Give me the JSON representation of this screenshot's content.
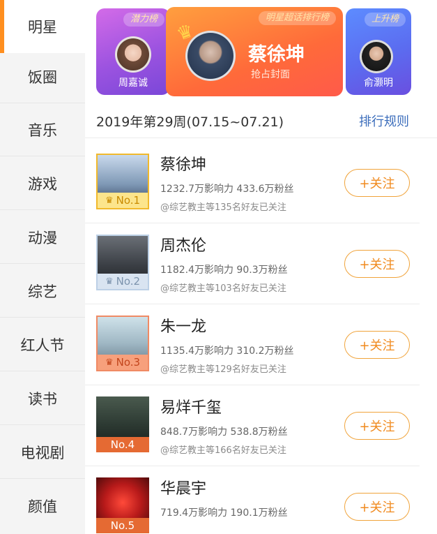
{
  "sidebar": {
    "items": [
      {
        "label": "明星",
        "active": true
      },
      {
        "label": "饭圈"
      },
      {
        "label": "音乐"
      },
      {
        "label": "游戏"
      },
      {
        "label": "动漫"
      },
      {
        "label": "综艺"
      },
      {
        "label": "红人节"
      },
      {
        "label": "读书"
      },
      {
        "label": "电视剧"
      },
      {
        "label": "颜值"
      }
    ],
    "accent_color": "#ff8f1f"
  },
  "banner": {
    "left_card": {
      "tag": "潜力榜",
      "name": "周嘉诚"
    },
    "center_card": {
      "tag": "明星超话排行榜",
      "title": "蔡徐坤",
      "subtitle": "抢占封面"
    },
    "right_card": {
      "tag": "上升榜",
      "name": "俞灏明"
    }
  },
  "header": {
    "week": "2019年第29周(07.15~07.21)",
    "rules_link": "排行规则"
  },
  "ranking": [
    {
      "name": "蔡徐坤",
      "stats": "1232.7万影响力 433.6万粉丝",
      "friends": "@综艺教主等135名好友已关注",
      "rank": "No.1",
      "follow": "+关注"
    },
    {
      "name": "周杰伦",
      "stats": "1182.4万影响力 90.3万粉丝",
      "friends": "@综艺教主等103名好友已关注",
      "rank": "No.2",
      "follow": "+关注"
    },
    {
      "name": "朱一龙",
      "stats": "1135.4万影响力 310.2万粉丝",
      "friends": "@综艺教主等129名好友已关注",
      "rank": "No.3",
      "follow": "+关注"
    },
    {
      "name": "易烊千玺",
      "stats": "848.7万影响力 538.8万粉丝",
      "friends": "@综艺教主等166名好友已关注",
      "rank": "No.4",
      "follow": "+关注"
    },
    {
      "name": "华晨宇",
      "stats": "719.4万影响力 190.1万粉丝",
      "friends": "",
      "rank": "No.5",
      "follow": "+关注"
    }
  ],
  "colors": {
    "follow": "#f08a1e",
    "link": "#3b6dbb"
  }
}
